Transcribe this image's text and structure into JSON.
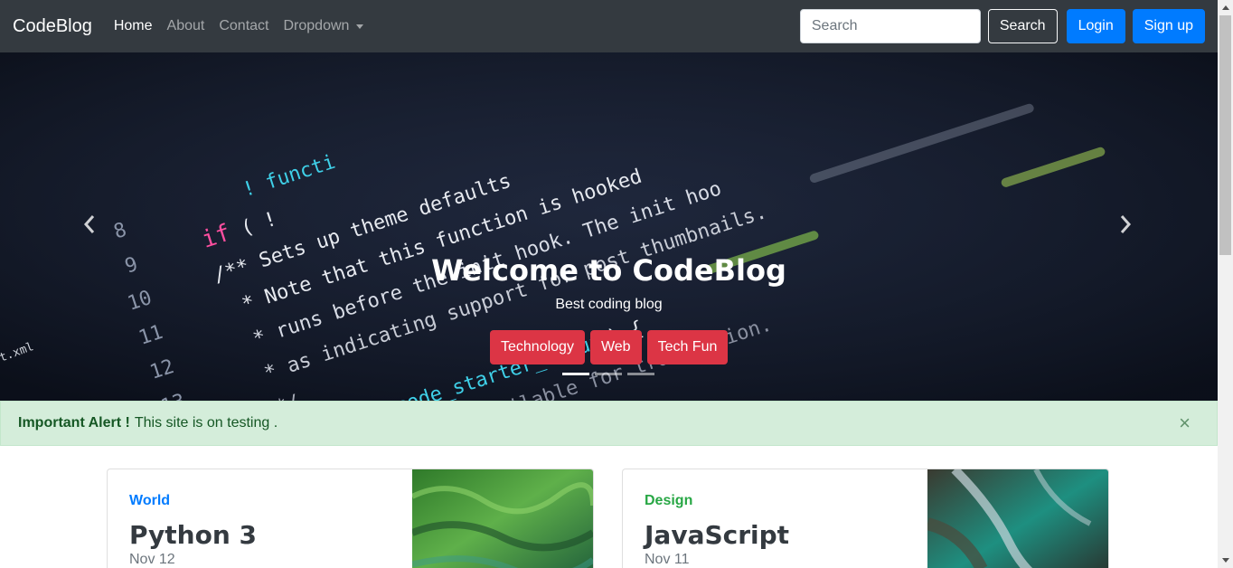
{
  "navbar": {
    "brand": "CodeBlog",
    "links": [
      {
        "label": "Home",
        "active": true
      },
      {
        "label": "About",
        "active": false
      },
      {
        "label": "Contact",
        "active": false
      },
      {
        "label": "Dropdown",
        "active": false
      }
    ],
    "search_placeholder": "Search",
    "search_button": "Search",
    "login_button": "Login",
    "signup_button": "Sign up",
    "colors": {
      "navbar_bg": "#343a40",
      "primary": "#007bff"
    }
  },
  "carousel": {
    "title": "Welcome to CodeBlog",
    "subtitle": "Best coding blog",
    "tags": [
      "Technology",
      "Web",
      "Tech Fun"
    ],
    "active_slide": 1,
    "slide_count": 3,
    "prev_icon": "chevron-left-icon",
    "next_icon": "chevron-right-icon",
    "tag_color": "#dc3545"
  },
  "alert": {
    "strong": "Important Alert !",
    "text": "This site is on testing .",
    "close": "×",
    "color": "#155724"
  },
  "cards": [
    {
      "category": "World",
      "title": "Python 3",
      "date": "Nov 12",
      "category_color": "#007bff"
    },
    {
      "category": "Design",
      "title": "JavaScript",
      "date": "Nov 11",
      "category_color": "#28a745"
    }
  ]
}
